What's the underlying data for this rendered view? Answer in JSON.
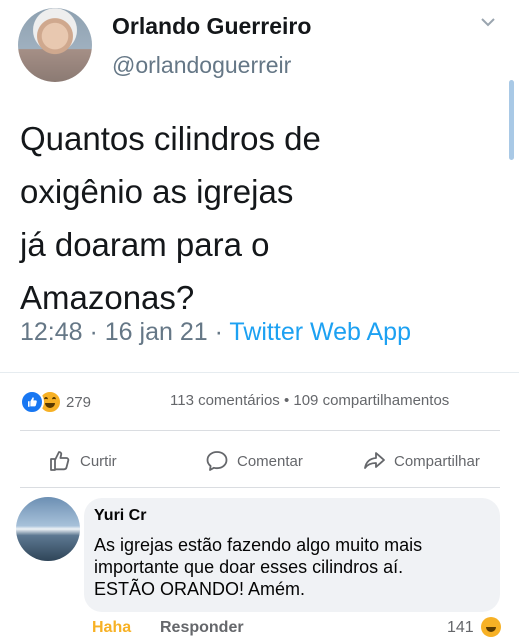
{
  "tweet": {
    "name": "Orlando Guerreiro",
    "handle": "@orlandoguerreir",
    "text": "Quantos cilindros de\noxigênio as igrejas\njá doaram para o\nAmazonas?",
    "time": "12:48 · 16 jan 21 · ",
    "source": "Twitter Web App"
  },
  "facebook": {
    "reaction_count": "279",
    "stats": "113 comentários • 109 compartilhamentos",
    "actions": {
      "like": "Curtir",
      "comment": "Comentar",
      "share": "Compartilhar"
    },
    "comment": {
      "author": "Yuri Cr",
      "text": "As igrejas estão fazendo algo muito mais\nimportante que doar esses cilindros aí.\nESTÃO ORANDO! Amém.",
      "haha_label": "Haha",
      "reply_label": "Responder",
      "reaction_count": "141"
    }
  },
  "colors": {
    "twitter_blue": "#1da1f2",
    "facebook_blue": "#1877f2",
    "haha_yellow": "#f7b125",
    "muted_gray": "#657786"
  },
  "icons": [
    "chevron-down-icon",
    "like-reaction-icon",
    "haha-reaction-icon",
    "thumbs-up-icon",
    "comment-icon",
    "share-icon"
  ]
}
